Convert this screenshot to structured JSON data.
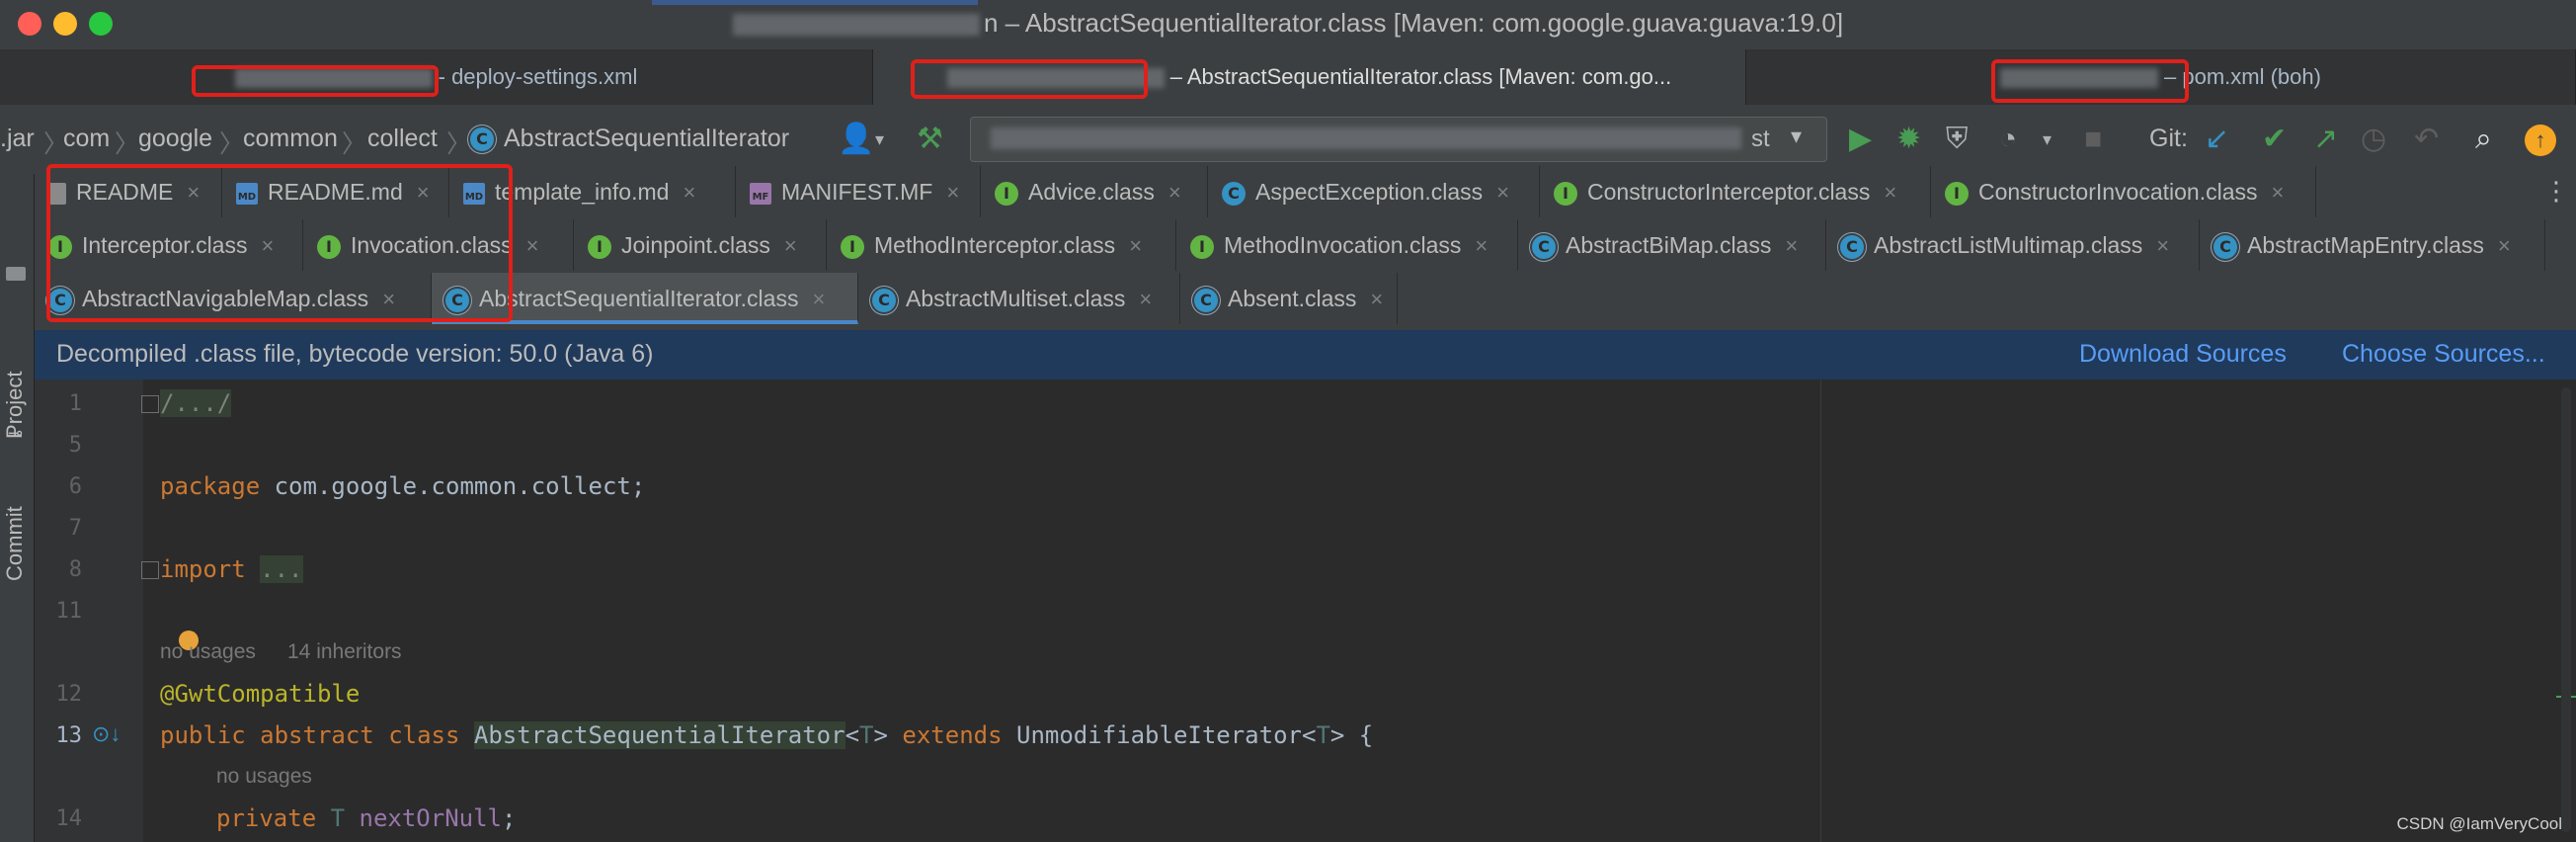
{
  "window": {
    "title_suffix": "n – AbstractSequentialIterator.class [Maven: com.google.guava:guava:19.0]"
  },
  "project_tabs": [
    {
      "label": "- deploy-settings.xml",
      "visible_fragment": "aas rp"
    },
    {
      "label": "– AbstractSequentialIterator.class [Maven: com.go...",
      "visible_fragment": "tion"
    },
    {
      "label": "– pom.xml (boh)",
      "visible_fragment": "po n"
    }
  ],
  "breadcrumb": [
    ".jar",
    "com",
    "google",
    "common",
    "collect",
    "AbstractSequentialIterator"
  ],
  "toolbar": {
    "config_tail": "st",
    "git_label": "Git:"
  },
  "side_labels": {
    "project": "Project",
    "commit": "Commit"
  },
  "editor_tabs": {
    "row1": [
      {
        "label": "README",
        "icon": "doc"
      },
      {
        "label": "README.md",
        "icon": "md"
      },
      {
        "label": "template_info.md",
        "icon": "md"
      },
      {
        "label": "MANIFEST.MF",
        "icon": "mf"
      },
      {
        "label": "Advice.class",
        "icon": "I"
      },
      {
        "label": "AspectException.class",
        "icon": "C"
      },
      {
        "label": "ConstructorInterceptor.class",
        "icon": "I"
      },
      {
        "label": "ConstructorInvocation.class",
        "icon": "I"
      }
    ],
    "row2": [
      {
        "label": "Interceptor.class",
        "icon": "I"
      },
      {
        "label": "Invocation.class",
        "icon": "I"
      },
      {
        "label": "Joinpoint.class",
        "icon": "I"
      },
      {
        "label": "MethodInterceptor.class",
        "icon": "I"
      },
      {
        "label": "MethodInvocation.class",
        "icon": "I"
      },
      {
        "label": "AbstractBiMap.class",
        "icon": "CA"
      },
      {
        "label": "AbstractListMultimap.class",
        "icon": "CA"
      },
      {
        "label": "AbstractMapEntry.class",
        "icon": "CA"
      }
    ],
    "row3": [
      {
        "label": "AbstractNavigableMap.class",
        "icon": "CA"
      },
      {
        "label": "AbstractSequentialIterator.class",
        "icon": "CA"
      },
      {
        "label": "AbstractMultiset.class",
        "icon": "CA"
      },
      {
        "label": "Absent.class",
        "icon": "CA"
      }
    ],
    "close_glyph": "×"
  },
  "banner": {
    "text": "Decompiled .class file, bytecode version: 50.0 (Java 6)",
    "download_sources": "Download Sources",
    "choose_sources": "Choose Sources..."
  },
  "code": {
    "line_numbers": [
      "1",
      "5",
      "6",
      "7",
      "8",
      "11",
      "12",
      "13",
      "14"
    ],
    "line1": "/.../",
    "line6_kw": "package",
    "line6_rest": " com.google.common.collect;",
    "line8_kw": "import",
    "line8_rest": "...",
    "hint_usages": "no usages",
    "hint_inheritors": "14 inheritors",
    "line12": "@GwtCompatible",
    "line13_kw": "public abstract class ",
    "line13_name": "AbstractSequentialIterator",
    "line13_lt": "<",
    "line13_t": "T",
    "line13_gt": "> ",
    "line13_extends": "extends",
    "line13_super": " UnmodifiableIterator<",
    "line13_t2": "T",
    "line13_end": "> {",
    "hint_usages2": "no usages",
    "line14_kw": "private ",
    "line14_t": "T",
    "line14_field": " nextOrNull",
    "line14_end": ";"
  },
  "watermark": "CSDN @IamVeryCool"
}
